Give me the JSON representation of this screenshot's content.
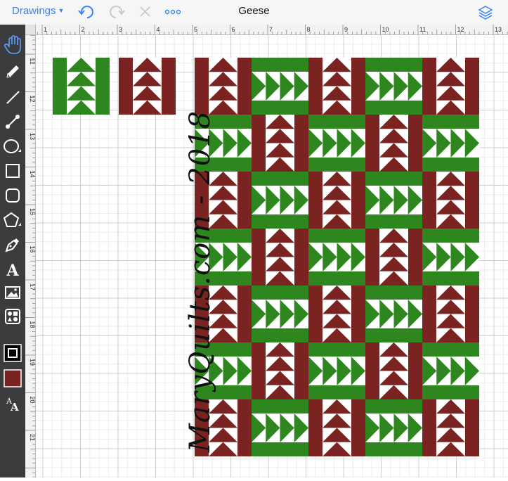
{
  "topbar": {
    "drawings_label": "Drawings",
    "title": "Geese"
  },
  "ruler": {
    "top_numbers": [
      "1",
      "2",
      "3",
      "4",
      "5",
      "6",
      "7",
      "8",
      "9",
      "10",
      "11",
      "12",
      "13"
    ],
    "left_numbers": [
      "11",
      "12",
      "13",
      "14",
      "15",
      "16",
      "17",
      "18",
      "19",
      "20",
      "21"
    ]
  },
  "toolbar": {
    "fill_color": "#7a2321",
    "tools": [
      "hand-icon",
      "pencil-icon",
      "line-icon",
      "connector-icon",
      "ellipse-icon",
      "rectangle-icon",
      "rounded-rectangle-icon",
      "polygon-icon",
      "pen-icon",
      "text-icon",
      "image-icon",
      "shapes-library-icon",
      "stroke-color-icon",
      "fill-color-icon",
      "text-style-icon"
    ]
  },
  "quilt": {
    "colors": {
      "red": "#7a2321",
      "green": "#2e861f",
      "white": "#ffffff"
    },
    "sample_blocks": [
      "vertical-green",
      "vertical-red"
    ],
    "rows": [
      [
        "vertical-red",
        "horizontal-green",
        "vertical-red",
        "horizontal-green",
        "vertical-red"
      ],
      [
        "horizontal-green",
        "vertical-red",
        "horizontal-green",
        "vertical-red",
        "horizontal-green"
      ],
      [
        "vertical-red",
        "horizontal-green",
        "vertical-red",
        "horizontal-green",
        "vertical-red"
      ],
      [
        "horizontal-green",
        "vertical-red",
        "horizontal-green",
        "vertical-red",
        "horizontal-green"
      ],
      [
        "vertical-red",
        "horizontal-green",
        "vertical-red",
        "horizontal-green",
        "vertical-red"
      ],
      [
        "horizontal-green",
        "vertical-red",
        "horizontal-green",
        "vertical-red",
        "horizontal-green"
      ],
      [
        "vertical-red",
        "horizontal-green",
        "vertical-red",
        "horizontal-green",
        "vertical-red"
      ]
    ]
  },
  "watermark": {
    "text": "MaryQuilts.com - 2018"
  }
}
